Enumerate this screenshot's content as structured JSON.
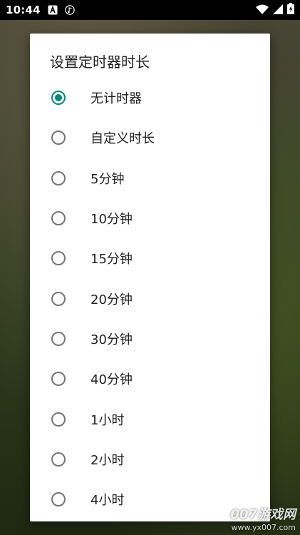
{
  "status_bar": {
    "time": "10:44",
    "icons": [
      "notification-a-icon",
      "music-icon",
      "wifi-icon",
      "signal-icon",
      "battery-icon"
    ]
  },
  "dialog": {
    "title": "设置定时器时长",
    "selected_index": 0,
    "options": [
      {
        "label": "无计时器",
        "checked": true
      },
      {
        "label": "自定义时长",
        "checked": false
      },
      {
        "label": "5分钟",
        "checked": false
      },
      {
        "label": "10分钟",
        "checked": false
      },
      {
        "label": "15分钟",
        "checked": false
      },
      {
        "label": "20分钟",
        "checked": false
      },
      {
        "label": "30分钟",
        "checked": false
      },
      {
        "label": "40分钟",
        "checked": false
      },
      {
        "label": "1小时",
        "checked": false
      },
      {
        "label": "2小时",
        "checked": false
      },
      {
        "label": "4小时",
        "checked": false
      }
    ]
  },
  "colors": {
    "accent": "#00897b",
    "radio_unchecked": "#757575"
  },
  "watermark": {
    "main": "007游戏网",
    "url": "www.yx007.com"
  }
}
